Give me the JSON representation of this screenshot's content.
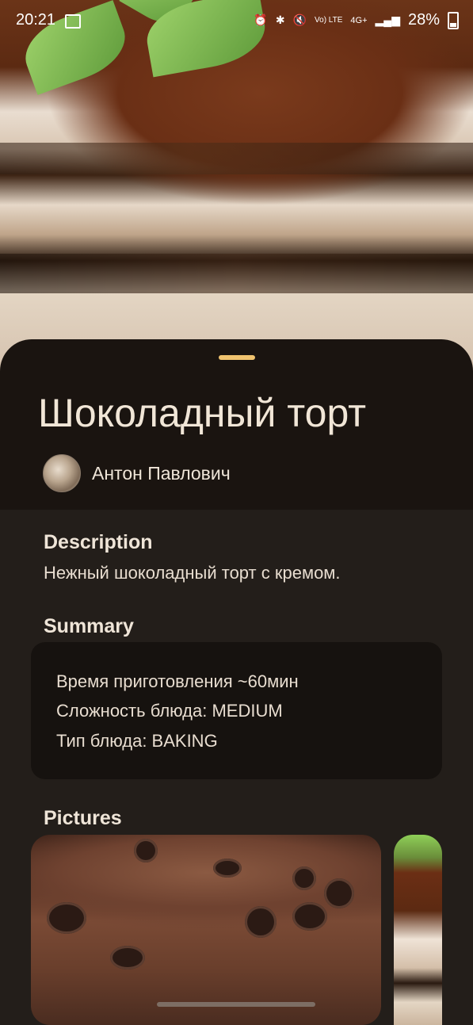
{
  "status_bar": {
    "time": "20:21",
    "battery": "28%",
    "icons": [
      "image-icon",
      "alarm-icon",
      "bluetooth-icon",
      "mute-icon",
      "volte-icon",
      "4g-icon",
      "signal-icon",
      "battery-icon"
    ],
    "volte_label": "Vo) LTE",
    "network_label": "4G+"
  },
  "recipe": {
    "title": "Шоколадный торт",
    "author": "Антон Павлович",
    "description_heading": "Description",
    "description": "Нежный шоколадный торт с кремом.",
    "summary_heading": "Summary",
    "summary": [
      "Время приготовления ~60мин",
      "Сложность блюда: MEDIUM",
      "Тип блюда: BAKING"
    ],
    "pictures_heading": "Pictures"
  },
  "colors": {
    "accent_handle": "#f0c36f",
    "background": "#231e1a",
    "sheet": "#1a1410",
    "card": "#16120f"
  }
}
